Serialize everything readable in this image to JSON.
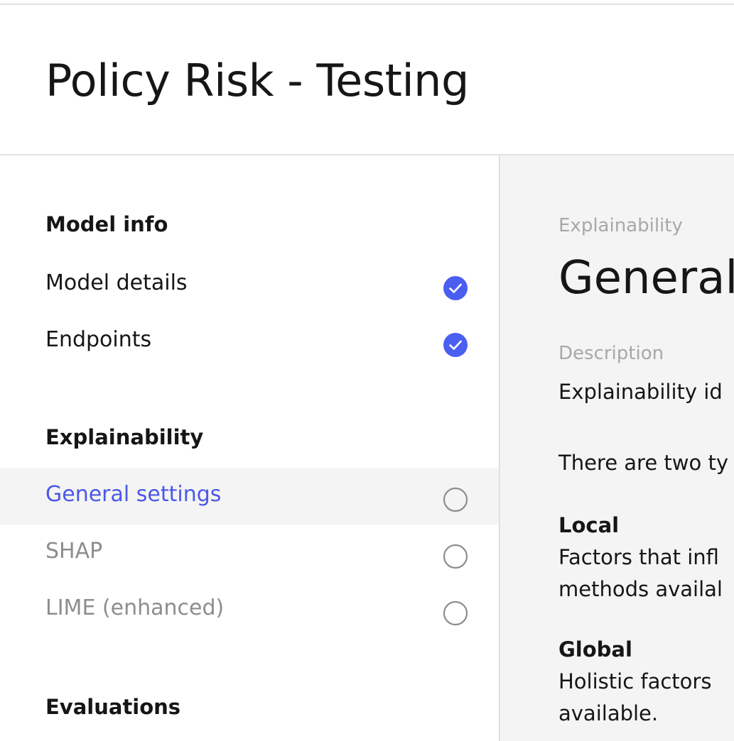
{
  "header": {
    "title": "Policy Risk - Testing"
  },
  "sidebar": {
    "sections": [
      {
        "heading": "Model info",
        "items": [
          {
            "label": "Model details",
            "status": "complete"
          },
          {
            "label": "Endpoints",
            "status": "complete"
          }
        ]
      },
      {
        "heading": "Explainability",
        "items": [
          {
            "label": "General settings",
            "status": "active"
          },
          {
            "label": "SHAP",
            "status": "incomplete"
          },
          {
            "label": "LIME (enhanced)",
            "status": "incomplete"
          }
        ]
      },
      {
        "heading": "Evaluations",
        "items": []
      }
    ]
  },
  "main": {
    "eyebrow": "Explainability",
    "heading": "General",
    "description_label": "Description",
    "description_line1": "Explainability id",
    "description_line2": "There are two ty",
    "local": {
      "title": "Local",
      "line1": "Factors that infl",
      "line2": "methods availal"
    },
    "global": {
      "title": "Global",
      "line1": "Holistic factors",
      "line2": "available."
    }
  },
  "colors": {
    "accent": "#4a58e8",
    "check_fill": "#4a5ef0",
    "muted_text": "#8d8d8d",
    "panel_bg": "#f4f4f4",
    "border": "#e0e0e0"
  },
  "icons": {
    "complete": "checkmark-filled-icon",
    "incomplete": "circle-outline-icon"
  }
}
